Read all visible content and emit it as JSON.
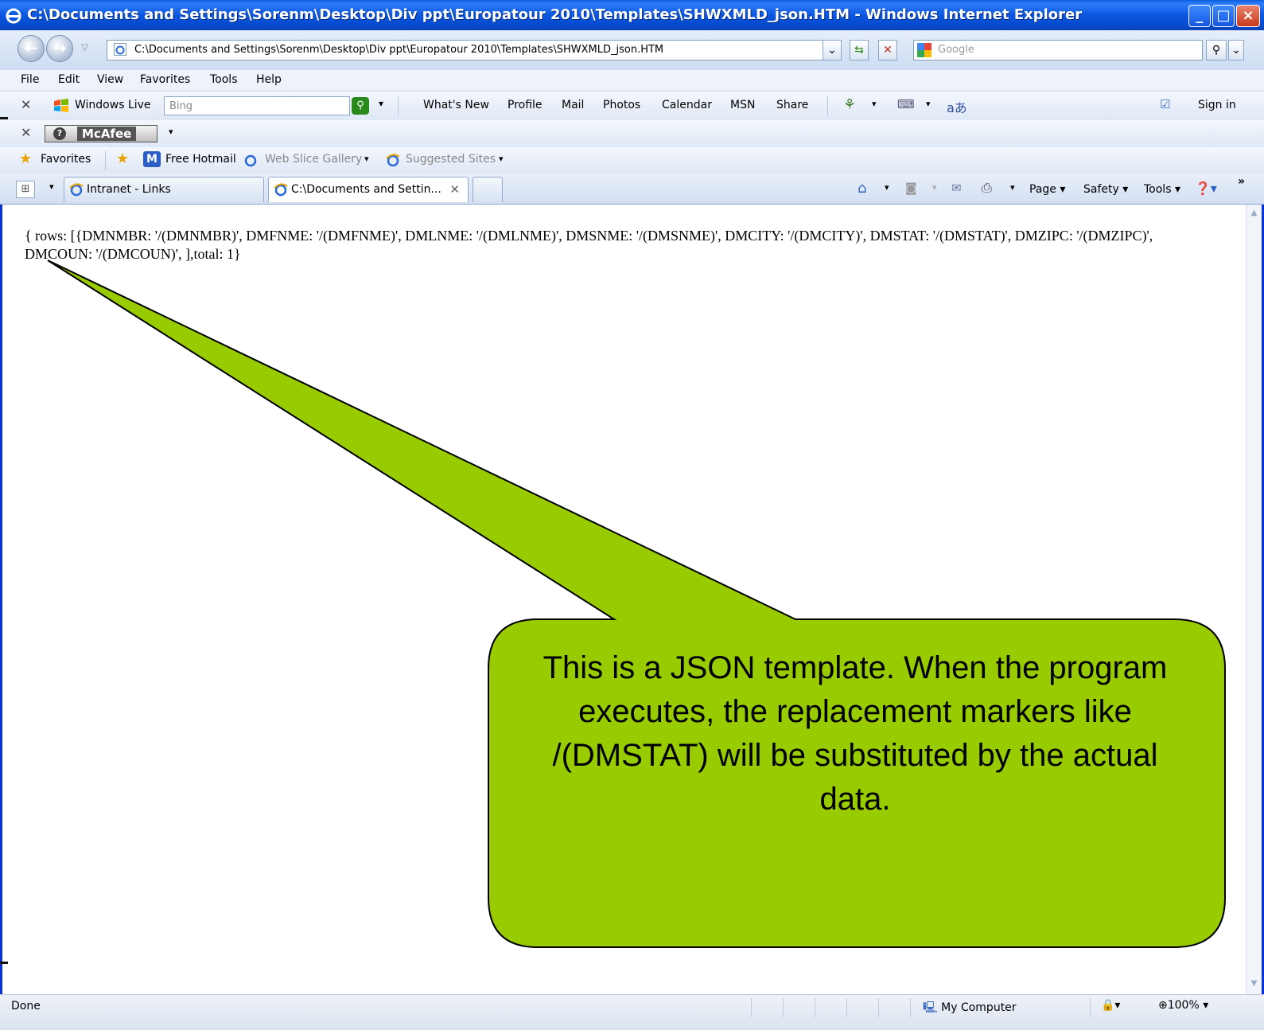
{
  "window": {
    "title": "C:\\Documents and Settings\\Sorenm\\Desktop\\Div ppt\\Europatour 2010\\Templates\\SHWXMLD_json.HTM - Windows Internet Explorer"
  },
  "address_bar": {
    "url": "C:\\Documents and Settings\\Sorenm\\Desktop\\Div ppt\\Europatour 2010\\Templates\\SHWXMLD_json.HTM",
    "search_placeholder": "Google"
  },
  "menu": {
    "file": "File",
    "edit": "Edit",
    "view": "View",
    "favorites": "Favorites",
    "tools": "Tools",
    "help": "Help"
  },
  "windows_live_toolbar": {
    "brand": "Windows Live",
    "search_placeholder": "Bing",
    "links": [
      "What's New",
      "Profile",
      "Mail",
      "Photos",
      "Calendar",
      "MSN",
      "Share"
    ],
    "sign_in": "Sign in"
  },
  "mcafee_toolbar": {
    "label": "McAfee"
  },
  "favorites_bar": {
    "favorites": "Favorites",
    "free_hotmail": "Free Hotmail",
    "web_slice_gallery": "Web Slice Gallery",
    "suggested_sites": "Suggested Sites"
  },
  "tabs": [
    {
      "label": "Intranet - Links",
      "active": false
    },
    {
      "label": "C:\\Documents and Settin...",
      "active": true
    }
  ],
  "command_bar": {
    "page": "Page",
    "safety": "Safety",
    "tools": "Tools"
  },
  "content": {
    "json_text": "{ rows: [{DMNMBR: '/(DMNMBR)', DMFNME: '/(DMFNME)', DMLNME: '/(DMLNME)', DMSNME: '/(DMSNME)', DMCITY: '/(DMCITY)', DMSTAT: '/(DMSTAT)', DMZIPC: '/(DMZIPC)', DMCOUN: '/(DMCOUN)', ],total: 1}"
  },
  "callout": {
    "text": "This is a JSON template. When the program executes, the replacement markers like /(DMSTAT) will be substituted by the actual data.",
    "fill_color": "#99cc00"
  },
  "status_bar": {
    "status": "Done",
    "zone": "My Computer",
    "zoom": "100%"
  }
}
